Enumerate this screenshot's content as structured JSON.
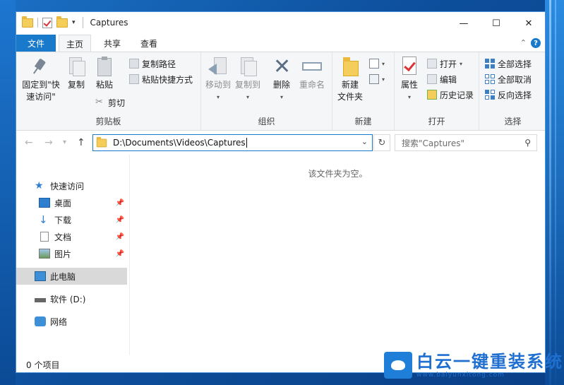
{
  "window": {
    "title": "Captures"
  },
  "titlebar": {
    "minimize": "—",
    "maximize": "☐",
    "close": "✕",
    "qat_dropdown": "▾"
  },
  "tabs": {
    "file": "文件",
    "home": "主页",
    "share": "共享",
    "view": "查看",
    "collapse": "⌃",
    "help": "?"
  },
  "ribbon": {
    "clipboard": {
      "label": "剪贴板",
      "pin_quick": "固定到\"快\n速访问\"",
      "copy": "复制",
      "paste": "粘贴",
      "copy_path": "复制路径",
      "paste_shortcut": "粘贴快捷方式",
      "cut": "剪切"
    },
    "organize": {
      "label": "组织",
      "move_to": "移动到",
      "copy_to": "复制到",
      "delete": "删除",
      "rename": "重命名"
    },
    "new": {
      "label": "新建",
      "new_folder": "新建\n文件夹"
    },
    "open": {
      "label": "打开",
      "properties": "属性",
      "open": "打开",
      "edit": "编辑",
      "history": "历史记录"
    },
    "select": {
      "label": "选择",
      "select_all": "全部选择",
      "select_none": "全部取消",
      "invert": "反向选择"
    }
  },
  "address": {
    "path": "D:\\Documents\\Videos\\Captures"
  },
  "search": {
    "placeholder": "搜索\"Captures\""
  },
  "nav": {
    "quick_access": "快速访问",
    "desktop": "桌面",
    "downloads": "下载",
    "documents": "文档",
    "pictures": "图片",
    "this_pc": "此电脑",
    "drive_d": "软件 (D:)",
    "network": "网络"
  },
  "content": {
    "empty_message": "该文件夹为空。"
  },
  "status": {
    "item_count": "0 个项目"
  },
  "watermark": {
    "title": "白云一键重装系统",
    "url": "www.baiyunxitong.com"
  }
}
